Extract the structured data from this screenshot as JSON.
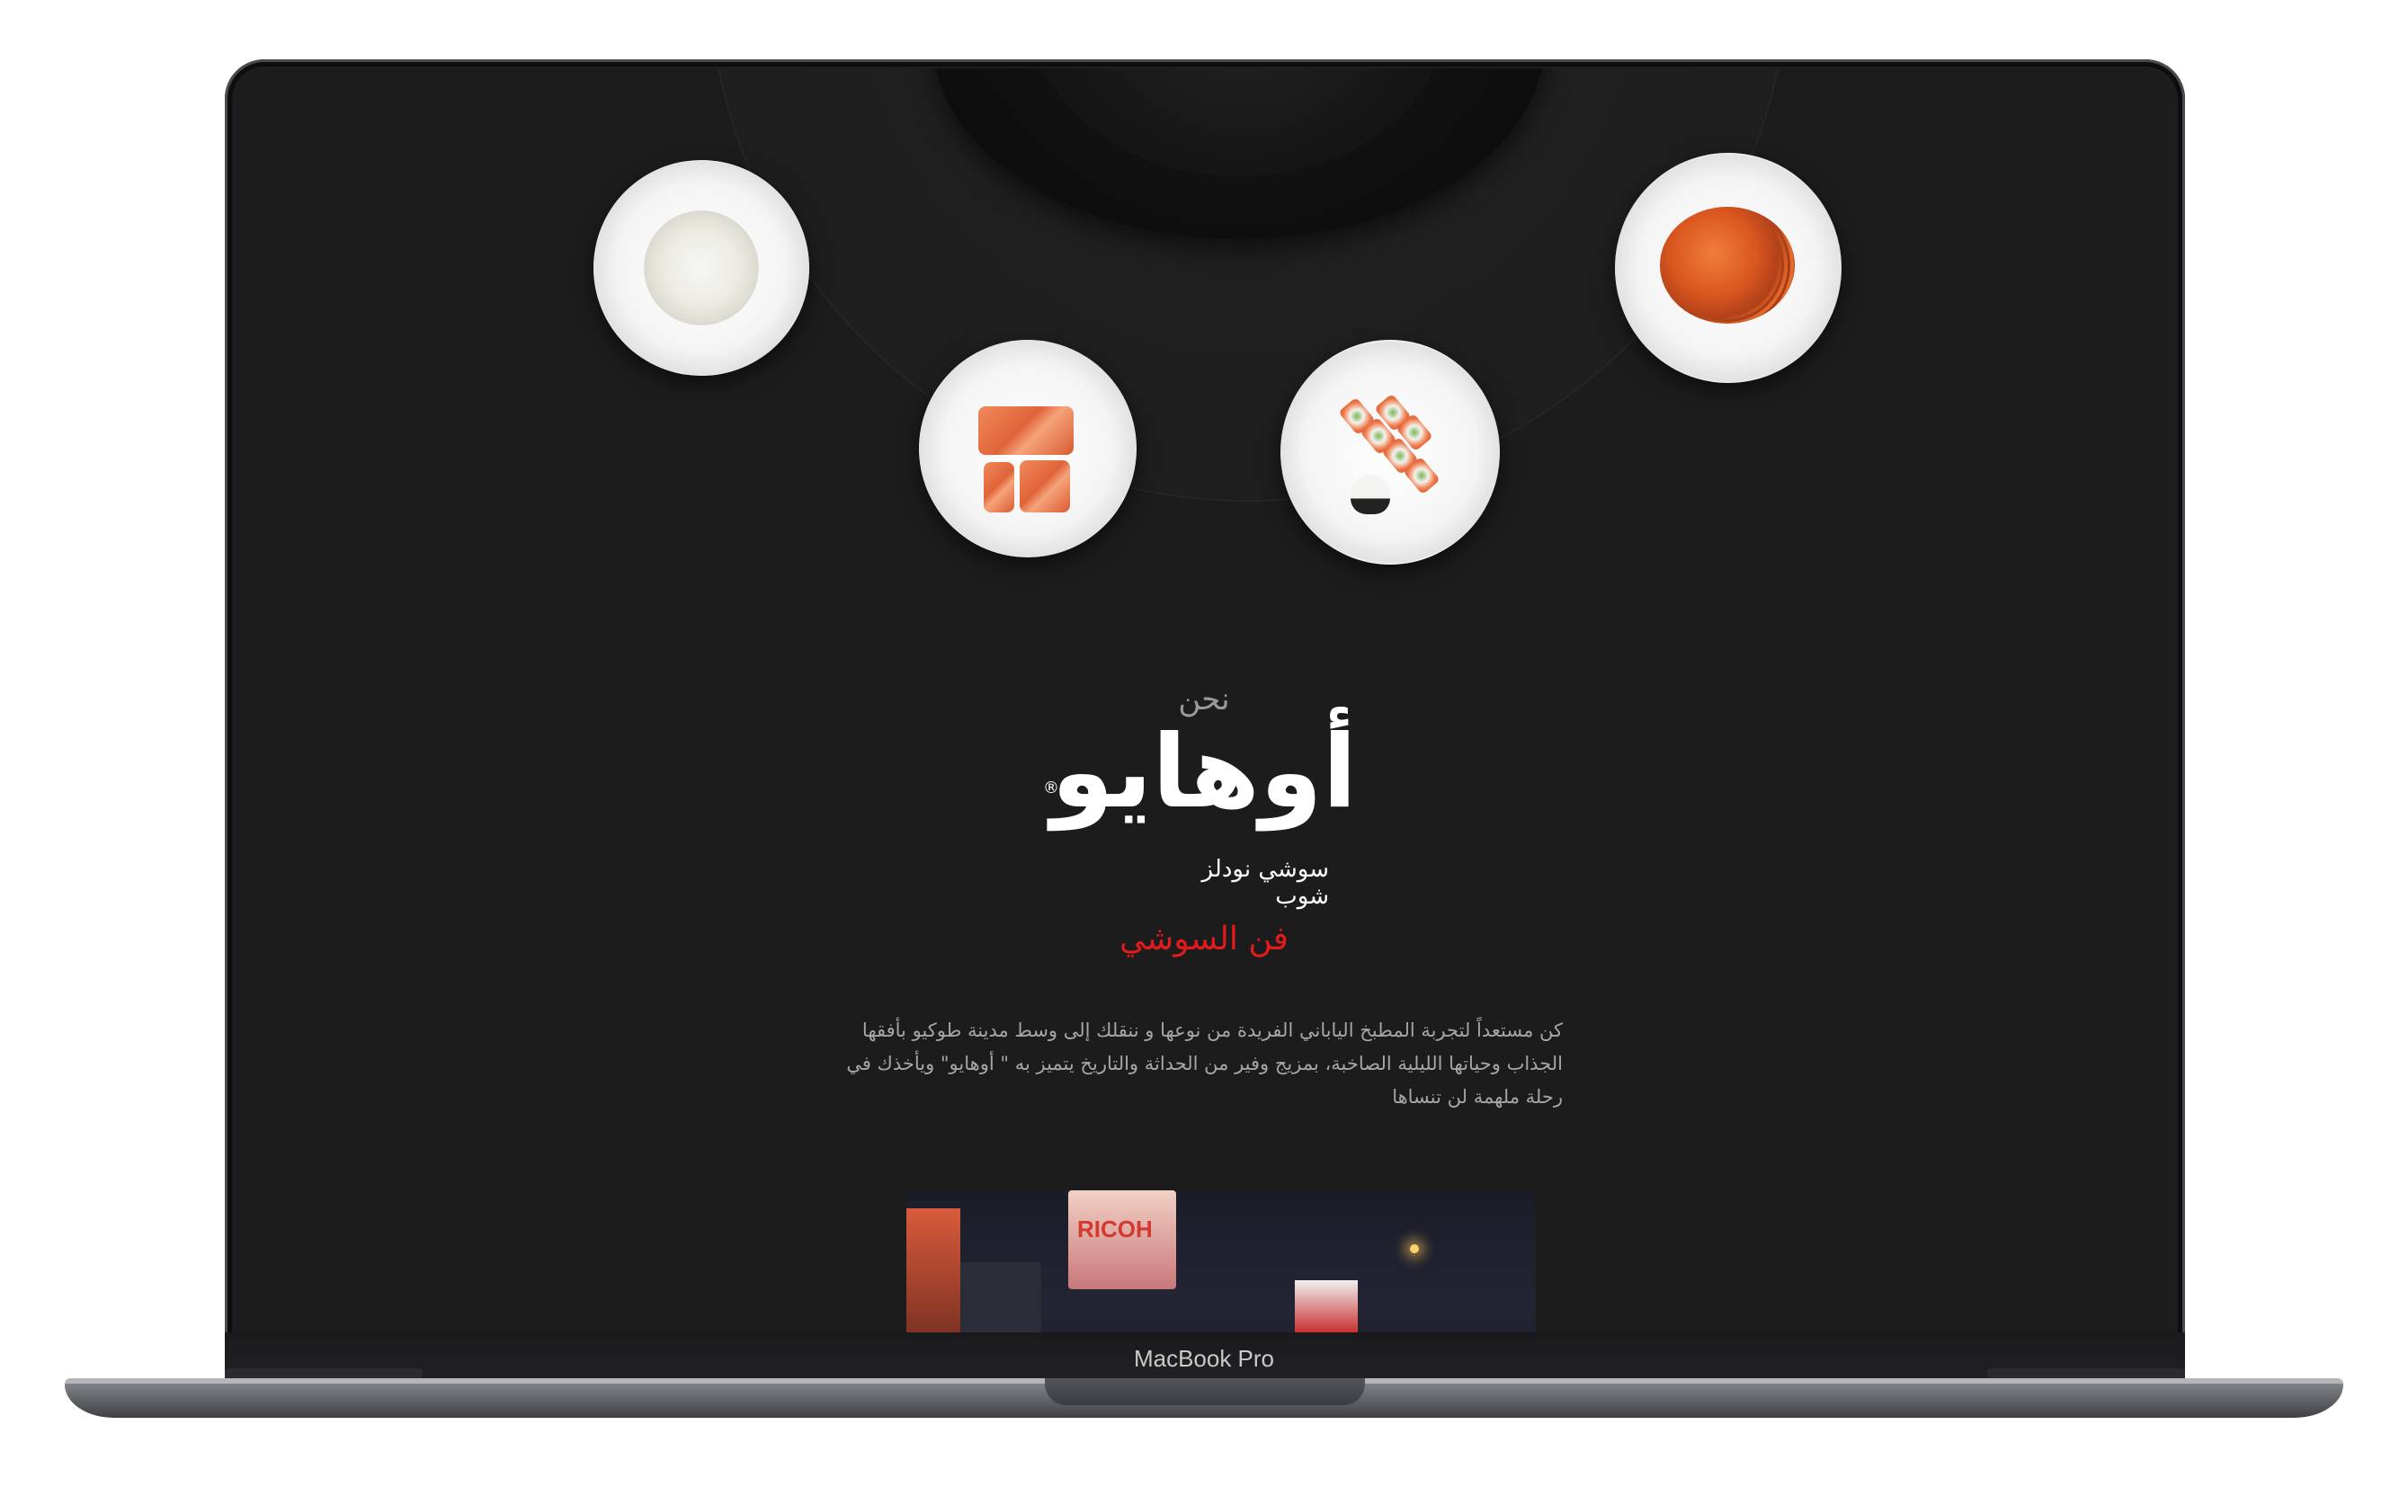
{
  "device": {
    "brand_label": "MacBook Pro"
  },
  "hero": {
    "pre_title": "نحن",
    "logo_text": "أوهايو",
    "registered_mark": "®",
    "logo_sub_line1": "سوشي نودلز",
    "logo_sub_line2": "شوب",
    "accent_title": "فن السوشي",
    "description": "كن مستعداً لتجربة المطبخ الياباني الفريدة من نوعها و ننقلك إلى وسط مدينة طوكيو بأفقها الجذاب وحياتها الليلية الصاخبة، بمزيج  وفير من الحداثة والتاريخ يتميز به \" أوهايو\" ويأخذك في رحلة ملهمة لن تنساها"
  },
  "dishes": [
    {
      "name": "rice"
    },
    {
      "name": "salmon"
    },
    {
      "name": "sushi-rolls"
    },
    {
      "name": "noodles"
    }
  ],
  "photo": {
    "sign_text": "RICOH"
  },
  "colors": {
    "accent": "#e11b1b",
    "background": "#1c1c1c",
    "text_muted": "#a6a6a6"
  }
}
